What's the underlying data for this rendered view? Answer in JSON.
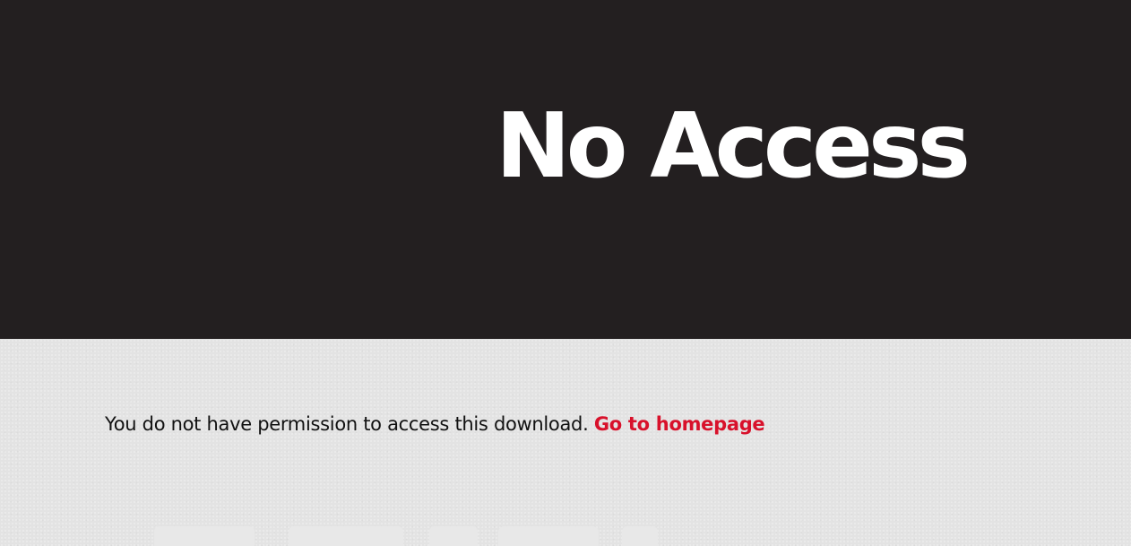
{
  "hero": {
    "title": "No Access"
  },
  "content": {
    "message": "You do not have permission to access this download.",
    "link_label": "Go to homepage"
  },
  "colors": {
    "hero_background": "#231f20",
    "hero_text": "#ffffff",
    "page_background": "#e3e3e3",
    "link": "#d8112b",
    "body_text": "#111111"
  }
}
